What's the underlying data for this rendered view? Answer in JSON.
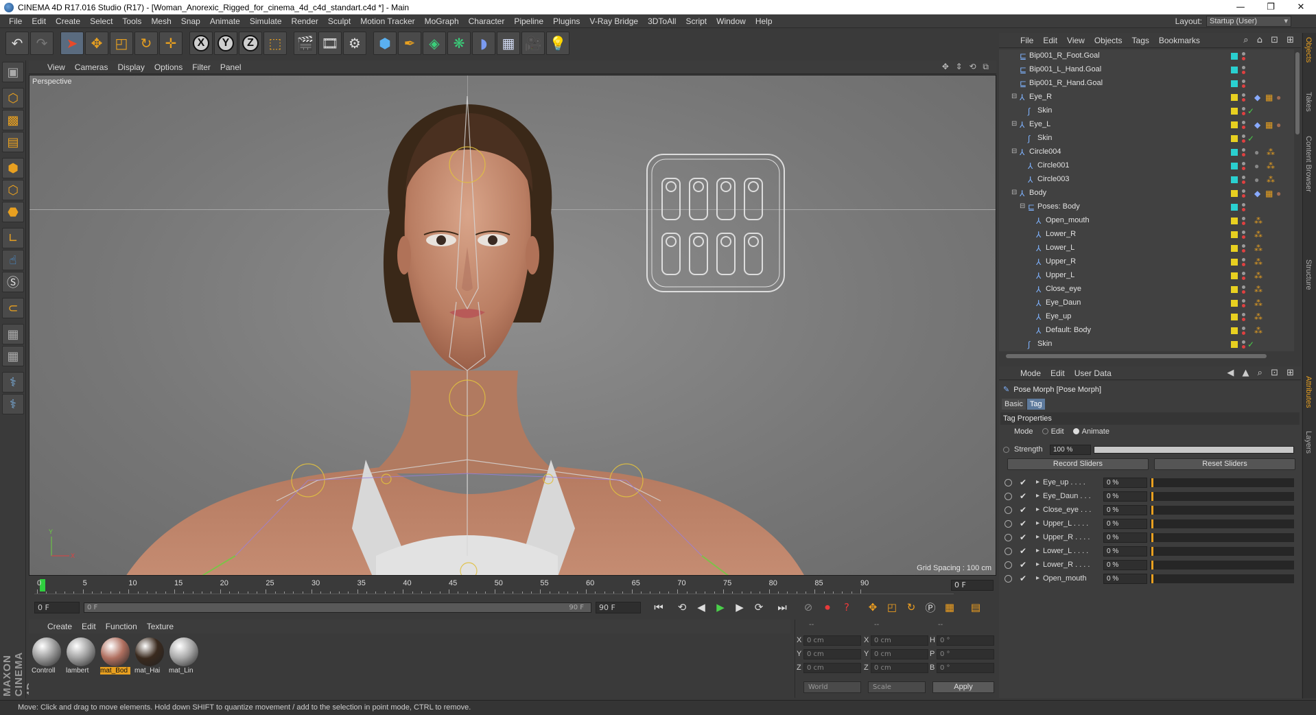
{
  "window": {
    "title": "CINEMA 4D R17.016 Studio (R17) - [Woman_Anorexic_Rigged_for_cinema_4d_c4d_standart.c4d *] - Main",
    "minimize": "—",
    "maximize": "❐",
    "close": "✕"
  },
  "menu": [
    "File",
    "Edit",
    "Create",
    "Select",
    "Tools",
    "Mesh",
    "Snap",
    "Animate",
    "Simulate",
    "Render",
    "Sculpt",
    "Motion Tracker",
    "MoGraph",
    "Character",
    "Pipeline",
    "Plugins",
    "V-Ray Bridge",
    "3DToAll",
    "Script",
    "Window",
    "Help"
  ],
  "layout": {
    "label": "Layout:",
    "value": "Startup (User)"
  },
  "viewport": {
    "menu": [
      "View",
      "Cameras",
      "Display",
      "Options",
      "Filter",
      "Panel"
    ],
    "camera": "Perspective",
    "grid_spacing": "Grid Spacing : 100 cm"
  },
  "timeline": {
    "ticks": [
      "0",
      "5",
      "10",
      "15",
      "20",
      "25",
      "30",
      "35",
      "40",
      "45",
      "50",
      "55",
      "60",
      "65",
      "70",
      "75",
      "80",
      "85",
      "90"
    ],
    "current_frame": "0 F",
    "start": "0 F",
    "slider_start": "0 F",
    "slider_end": "90 F",
    "end": "90 F"
  },
  "materials": {
    "menu": [
      "Create",
      "Edit",
      "Function",
      "Texture"
    ],
    "items": [
      {
        "name": "Controll",
        "color": "#9a9a9a",
        "selected": false
      },
      {
        "name": "lambert",
        "color": "#a0a0a0",
        "selected": false
      },
      {
        "name": "mat_Bod",
        "color": "#b07060",
        "selected": true
      },
      {
        "name": "mat_Hai",
        "color": "#3a2a1e",
        "selected": false
      },
      {
        "name": "mat_Lin",
        "color": "#a8a8a8",
        "selected": false
      }
    ]
  },
  "coordinates": {
    "headers": [
      "--",
      "--",
      "--"
    ],
    "rows": [
      {
        "a": "X",
        "av": "0 cm",
        "b": "X",
        "bv": "0 cm",
        "c": "H",
        "cv": "0 °"
      },
      {
        "a": "Y",
        "av": "0 cm",
        "b": "Y",
        "bv": "0 cm",
        "c": "P",
        "cv": "0 °"
      },
      {
        "a": "Z",
        "av": "0 cm",
        "b": "Z",
        "bv": "0 cm",
        "c": "B",
        "cv": "0 °"
      }
    ],
    "space": "World",
    "mode": "Scale",
    "apply": "Apply"
  },
  "status": "Move: Click and drag to move elements. Hold down SHIFT to quantize movement / add to the selection in point mode, CTRL to remove.",
  "object_manager": {
    "menu": [
      "File",
      "Edit",
      "View",
      "Objects",
      "Tags",
      "Bookmarks"
    ],
    "rows": [
      {
        "name": "Bip001_R_Foot.Goal",
        "indent": 1,
        "icon": "goal",
        "layer": "#2ad0d0"
      },
      {
        "name": "Bip001_L_Hand.Goal",
        "indent": 1,
        "icon": "goal",
        "layer": "#2ad0d0"
      },
      {
        "name": "Bip001_R_Hand.Goal",
        "indent": 1,
        "icon": "goal",
        "layer": "#2ad0d0"
      },
      {
        "name": "Eye_R",
        "indent": 1,
        "icon": "mesh",
        "layer": "#e8d020",
        "expand": true
      },
      {
        "name": "Skin",
        "indent": 2,
        "icon": "skin",
        "layer": "#e8d020"
      },
      {
        "name": "Eye_L",
        "indent": 1,
        "icon": "mesh",
        "layer": "#e8d020",
        "expand": true
      },
      {
        "name": "Skin",
        "indent": 2,
        "icon": "skin",
        "layer": "#e8d020"
      },
      {
        "name": "Circle004",
        "indent": 1,
        "icon": "mesh",
        "layer": "#2ad0d0",
        "expand": true
      },
      {
        "name": "Circle001",
        "indent": 2,
        "icon": "mesh",
        "layer": "#2ad0d0"
      },
      {
        "name": "Circle003",
        "indent": 2,
        "icon": "mesh",
        "layer": "#2ad0d0"
      },
      {
        "name": "Body",
        "indent": 1,
        "icon": "mesh",
        "layer": "#e8d020",
        "expand": true
      },
      {
        "name": "Poses: Body",
        "indent": 2,
        "icon": "goal",
        "layer": "#2ad0d0",
        "expand": true
      },
      {
        "name": "Open_mouth",
        "indent": 3,
        "icon": "mesh",
        "layer": "#e8d020"
      },
      {
        "name": "Lower_R",
        "indent": 3,
        "icon": "mesh",
        "layer": "#e8d020"
      },
      {
        "name": "Lower_L",
        "indent": 3,
        "icon": "mesh",
        "layer": "#e8d020"
      },
      {
        "name": "Upper_R",
        "indent": 3,
        "icon": "mesh",
        "layer": "#e8d020"
      },
      {
        "name": "Upper_L",
        "indent": 3,
        "icon": "mesh",
        "layer": "#e8d020"
      },
      {
        "name": "Close_eye",
        "indent": 3,
        "icon": "mesh",
        "layer": "#e8d020"
      },
      {
        "name": "Eye_Daun",
        "indent": 3,
        "icon": "mesh",
        "layer": "#e8d020"
      },
      {
        "name": "Eye_up",
        "indent": 3,
        "icon": "mesh",
        "layer": "#e8d020"
      },
      {
        "name": "Default: Body",
        "indent": 3,
        "icon": "mesh",
        "layer": "#e8d020"
      },
      {
        "name": "Skin",
        "indent": 2,
        "icon": "skin",
        "layer": "#e8d020"
      }
    ]
  },
  "attribute_manager": {
    "menu": [
      "Mode",
      "Edit",
      "User Data"
    ],
    "title": "Pose Morph [Pose Morph]",
    "tabs": [
      "Basic",
      "Tag"
    ],
    "section": "Tag Properties",
    "mode_label": "Mode",
    "mode_options": [
      "Edit",
      "Animate"
    ],
    "strength_label": "Strength",
    "strength_value": "100 %",
    "record_sliders": "Record Sliders",
    "reset_sliders": "Reset Sliders",
    "sliders": [
      {
        "name": "Eye_up . . . .",
        "value": "0 %"
      },
      {
        "name": "Eye_Daun . . .",
        "value": "0 %"
      },
      {
        "name": "Close_eye . . .",
        "value": "0 %"
      },
      {
        "name": "Upper_L . . . .",
        "value": "0 %"
      },
      {
        "name": "Upper_R . . . .",
        "value": "0 %"
      },
      {
        "name": "Lower_L . . . .",
        "value": "0 %"
      },
      {
        "name": "Lower_R . . . .",
        "value": "0 %"
      },
      {
        "name": "Open_mouth",
        "value": "0 %"
      }
    ]
  },
  "side_tabs": [
    "Objects",
    "Takes",
    "Content Browser",
    "Structure",
    "Attributes",
    "Layers"
  ]
}
